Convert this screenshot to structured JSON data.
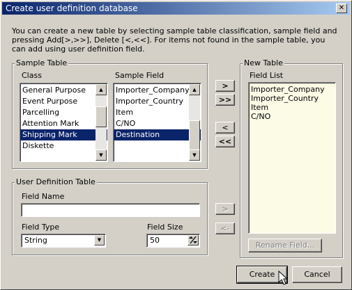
{
  "window": {
    "title": "Create user definition database",
    "close_glyph": "✕"
  },
  "description": "You can create a new table by selecting sample table classification, sample field and pressing Add[>,>>], Delete [<,<<]. For items not found in the sample table, you can add using user definition field.",
  "sample_table": {
    "group_label": "Sample Table",
    "class_label": "Class",
    "class_items": [
      "General Purpose",
      "Event Purpose",
      "Parcelling",
      "Attention Mark",
      "Shipping Mark",
      "Diskette"
    ],
    "class_selected_index": 4,
    "field_label": "Sample Field",
    "field_items": [
      "Importer_Company",
      "Importer_Country",
      "Item",
      "C/NO",
      "Destination"
    ],
    "field_selected_index": 4
  },
  "transfer_buttons": {
    "add": ">",
    "add_all": ">>",
    "remove": "<",
    "remove_all": "<<"
  },
  "user_definition": {
    "group_label": "User Definition Table",
    "field_name_label": "Field Name",
    "field_name_value": "",
    "field_type_label": "Field Type",
    "field_type_value": "String",
    "field_size_label": "Field Size",
    "field_size_value": "50",
    "add_button": ">",
    "remove_button": "<-"
  },
  "new_table": {
    "group_label": "New Table",
    "list_label": "Field List",
    "items": [
      "Importer_Company",
      "Importer_Country",
      "Item",
      "C/NO"
    ],
    "rename_button": "Rename Field..."
  },
  "footer": {
    "create": "Create",
    "cancel": "Cancel"
  },
  "colors": {
    "title_start": "#0a246a",
    "title_end": "#a6caf0",
    "selection": "#0a246a",
    "face": "#d4d0c8",
    "field_list_bg": "#fcfbe6"
  }
}
